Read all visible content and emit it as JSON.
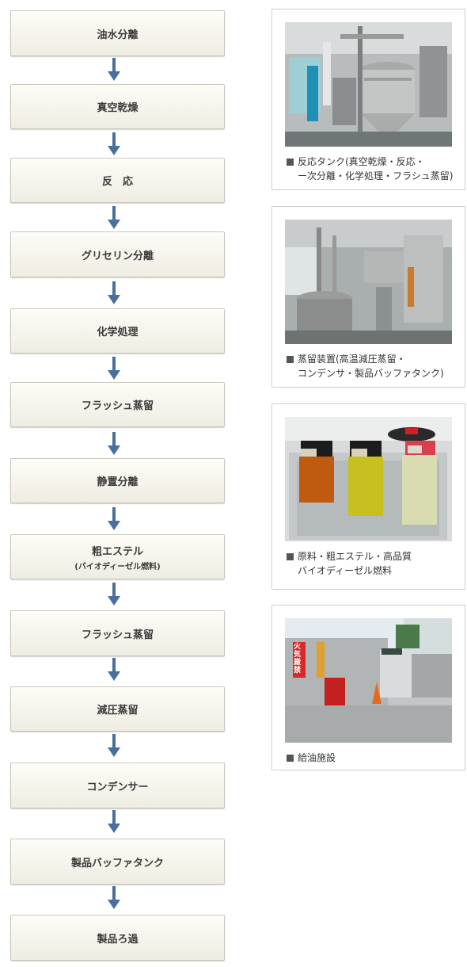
{
  "steps": [
    {
      "label": "油水分離"
    },
    {
      "label": "真空乾燥"
    },
    {
      "label": "反　応"
    },
    {
      "label": "グリセリン分離"
    },
    {
      "label": "化学処理"
    },
    {
      "label": "フラッシュ蒸留"
    },
    {
      "label": "静置分離"
    },
    {
      "label": "粗エステル",
      "sub": "(バイオディーゼル燃料)"
    },
    {
      "label": "フラッシュ蒸留"
    },
    {
      "label": "減圧蒸留"
    },
    {
      "label": "コンデンサー"
    },
    {
      "label": "製品バッファタンク"
    },
    {
      "label": "製品ろ過"
    }
  ],
  "photos": [
    {
      "line1": "反応タンク(真空乾燥・反応・",
      "line2": "ー次分離・化学処理・フラシュ蒸留)"
    },
    {
      "line1": "蒸留装置(高温減圧蒸留・",
      "line2": "コンデンサ・製品バッファタンク)"
    },
    {
      "line1": "原料・粗エステル・高品質",
      "line2": "バイオディーゼル燃料"
    },
    {
      "line1": "給油施設",
      "line2": ""
    }
  ],
  "signs": {
    "fire": "火気厳禁"
  },
  "colors": {
    "arrow": "#4a6f9c",
    "step_border": "#c9c6bc",
    "card_border": "#cfcfcf"
  }
}
